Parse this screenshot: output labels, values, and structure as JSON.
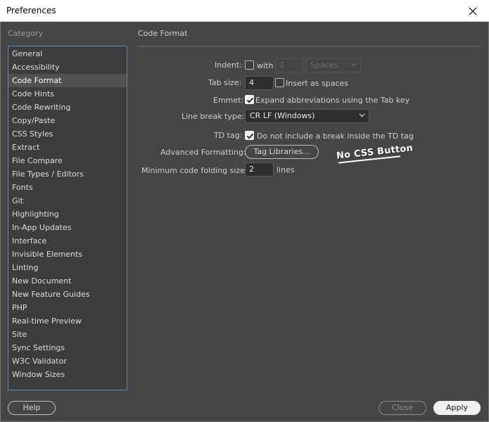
{
  "window": {
    "title": "Preferences"
  },
  "category": {
    "heading": "Category",
    "items": [
      "General",
      "Accessibility",
      "Code Format",
      "Code Hints",
      "Code Rewriting",
      "Copy/Paste",
      "CSS Styles",
      "Extract",
      "File Compare",
      "File Types / Editors",
      "Fonts",
      "Git",
      "Highlighting",
      "In-App Updates",
      "Interface",
      "Invisible Elements",
      "Linting",
      "New Document",
      "New Feature Guides",
      "PHP",
      "Real-time Preview",
      "Site",
      "Sync Settings",
      "W3C Validator",
      "Window Sizes"
    ],
    "selected": "Code Format"
  },
  "panel": {
    "title": "Code Format",
    "indent": {
      "label": "Indent:",
      "checked": false,
      "with_label": "with",
      "value": "2",
      "unit_value": "Spaces"
    },
    "tab_size": {
      "label": "Tab size:",
      "value": "4",
      "insert_label": "Insert as spaces",
      "insert_checked": false
    },
    "emmet": {
      "label": "Emmet:",
      "checked": true,
      "option_label": "Expand abbreviations using the Tab key"
    },
    "line_break": {
      "label": "Line break type:",
      "value": "CR LF (Windows)"
    },
    "td_tag": {
      "label": "TD tag:",
      "checked": true,
      "option_label": "Do not include a break inside the TD tag"
    },
    "advanced": {
      "label": "Advanced Formatting:",
      "button_label": "Tag Libraries..."
    },
    "folding": {
      "label": "Minimum code folding size:",
      "value": "2",
      "unit": "lines"
    },
    "annotation": "No CSS Button"
  },
  "footer": {
    "help_label": "Help",
    "close_label": "Close",
    "apply_label": "Apply"
  },
  "colors": {
    "background": "#464646",
    "list_background": "#3c3c3c",
    "list_border": "#5f86b3",
    "selected_row": "#505050"
  }
}
